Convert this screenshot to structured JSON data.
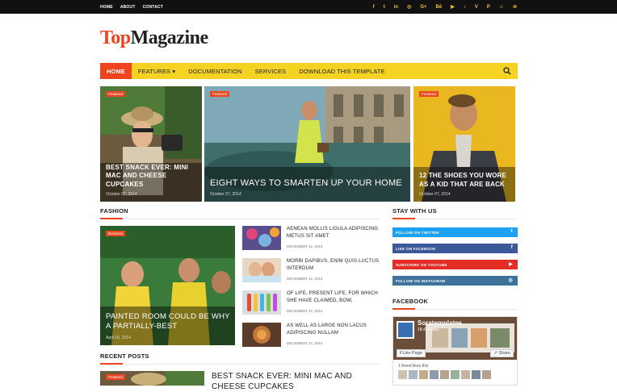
{
  "topbar": {
    "links": [
      "HOME",
      "ABOUT",
      "CONTACT"
    ],
    "social": [
      "f",
      "t",
      "in",
      "◎",
      "G+",
      "Bē",
      "▶",
      "♪",
      "V",
      "P",
      "☺",
      "≋"
    ]
  },
  "logo": {
    "first": "Top",
    "second": "Magazine"
  },
  "nav": {
    "items": [
      "HOME",
      "FEATURES ▾",
      "DOCUMENTATION",
      "SERVICES",
      "DOWNLOAD THIS TEMPLATE"
    ],
    "search_icon": "search-icon"
  },
  "featured": [
    {
      "badge": "Featured",
      "title": "BEST SNACK EVER: MINI MAC AND CHEESE CUPCAKES",
      "date": "October 07, 2014"
    },
    {
      "badge": "Featured",
      "title": "EIGHT WAYS TO SMARTEN UP YOUR HOME",
      "date": "October 07, 2014"
    },
    {
      "badge": "Featured",
      "title": "12 THE SHOES YOU WORE AS A KID THAT ARE BACK",
      "date": "October 07, 2014"
    }
  ],
  "fashion": {
    "heading": "FASHION",
    "big": {
      "badge": "Business",
      "title": "PAINTED ROOM COULD BE WHY A PARTIALLY-BEST",
      "date": "April 10, 2014"
    },
    "list": [
      {
        "title": "AENEAN MOLLIS LIGULA ADIPISCING METUS SIT AMET",
        "date": "DECEMBER 14, 2013"
      },
      {
        "title": "MORBI DAPIBUS, ENIM QUIS LUCTUS INTERDUM",
        "date": "DECEMBER 14, 2013"
      },
      {
        "title": "OF LIFE, PRESENT LIFE, FOR WHICH SHE HAVE CLAIMED, BOW,",
        "date": "DECEMBER 14, 2013"
      },
      {
        "title": "AS WELL AS LARGE NON LACUS ADIPISCING NULLAM",
        "date": "DECEMBER 14, 2013"
      }
    ]
  },
  "recent": {
    "heading": "RECENT POSTS",
    "badge": "Featured",
    "title": "BEST SNACK EVER: MINI MAC AND CHEESE CUPCAKES"
  },
  "sidebar": {
    "stay_heading": "STAY WITH US",
    "follow": [
      {
        "label": "FOLLOW ON TWITTER",
        "color": "#1da1f2",
        "icon": "t"
      },
      {
        "label": "LIKE ON FACEBOOK",
        "color": "#3b5998",
        "icon": "f"
      },
      {
        "label": "SUBSCRIBE ON YOUTUBE",
        "color": "#e52d27",
        "icon": "▶"
      },
      {
        "label": "FOLLOW ON INSTAGRAM",
        "color": "#3f729b",
        "icon": "◎"
      }
    ],
    "facebook_heading": "FACEBOOK",
    "fb": {
      "page_name": "Soratemplates",
      "likes": "18,425 likes",
      "like_button": "Like Page",
      "share_button": "Share",
      "friends": "1 friend likes this"
    }
  },
  "colors": {
    "accent": "#ee4420",
    "nav": "#f6d323",
    "topbar": "#111111"
  }
}
